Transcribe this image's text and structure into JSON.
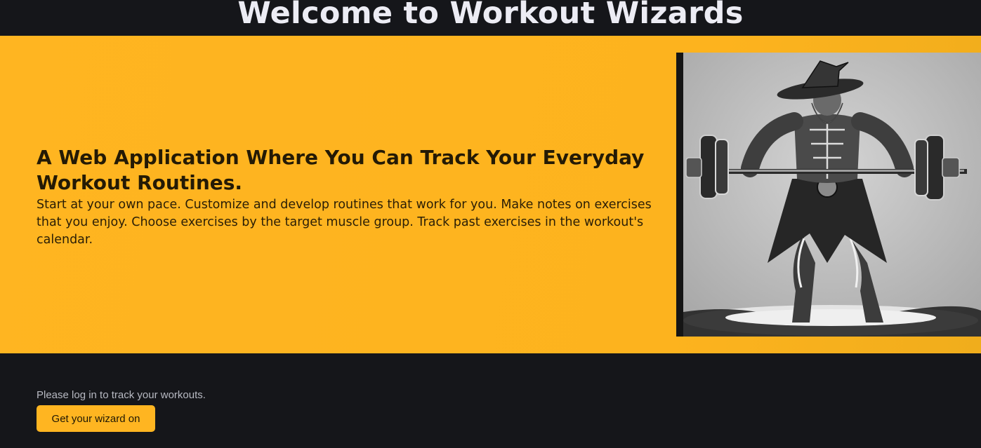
{
  "header": {
    "title": "Welcome to Workout Wizards"
  },
  "hero": {
    "heading": "A Web Application Where You Can Track Your Everyday Workout Routines.",
    "description": "Start at your own pace. Customize and develop routines that work for you. Make notes on exercises that you enjoy. Choose exercises by the target muscle group. Track past exercises in the workout's calendar.",
    "image_icon": "wizard-lifting-barbell-illustration"
  },
  "footer": {
    "login_prompt": "Please log in to track your workouts.",
    "cta_label": "Get your wizard on"
  },
  "colors": {
    "accent": "#ffb521",
    "background": "#15161a",
    "title_text": "#ececf4"
  }
}
